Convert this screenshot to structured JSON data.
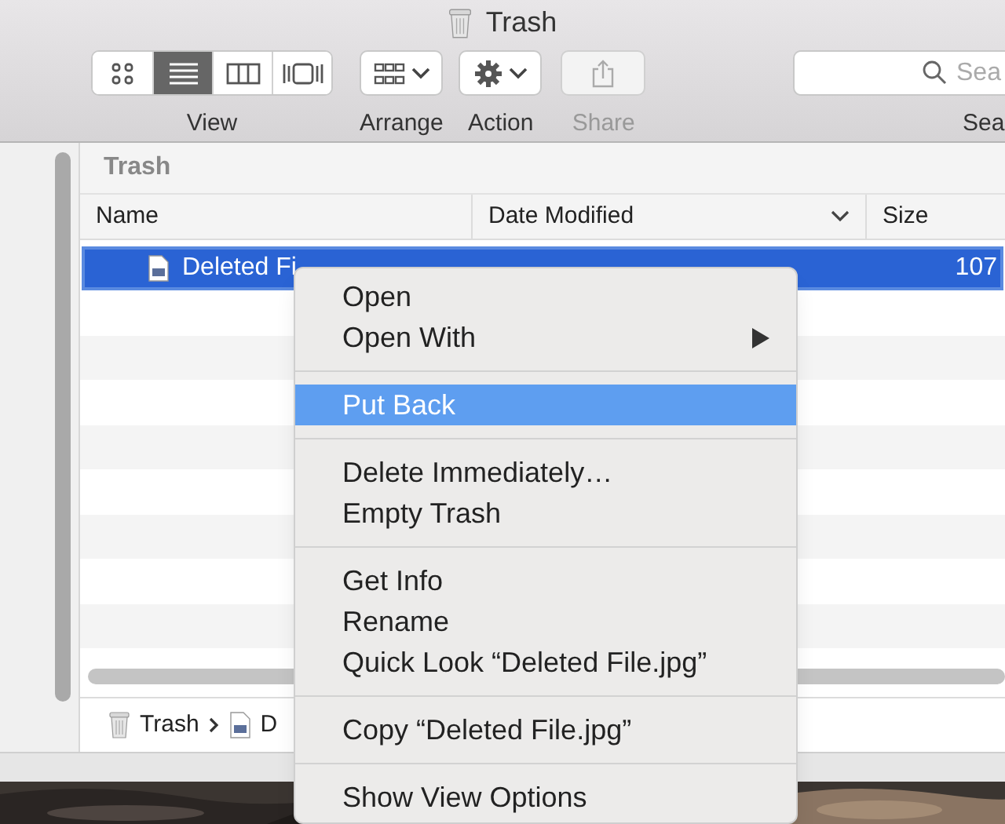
{
  "window": {
    "title": "Trash"
  },
  "toolbar": {
    "view_modes": [
      {
        "kind": "icons",
        "selected": false
      },
      {
        "kind": "list",
        "selected": true
      },
      {
        "kind": "columns",
        "selected": false
      },
      {
        "kind": "cover",
        "selected": false
      }
    ],
    "view_label": "View",
    "arrange_label": "Arrange",
    "action_label": "Action",
    "share": {
      "label": "Share",
      "disabled": true
    },
    "search": {
      "placeholder": "Sea",
      "label": "Sea"
    }
  },
  "location_header": "Trash",
  "table": {
    "columns": [
      {
        "label": "Name"
      },
      {
        "label": "Date Modified",
        "sorted": true
      },
      {
        "label": "Size"
      }
    ],
    "rows": [
      {
        "name": "Deleted Fi",
        "size": "107",
        "selected": true
      }
    ]
  },
  "path_bar": [
    "Trash",
    "D"
  ],
  "context_menu": [
    {
      "kind": "item",
      "label": "Open",
      "selected": false
    },
    {
      "kind": "item",
      "label": "Open With",
      "selected": false,
      "submenu": true
    },
    {
      "kind": "separator"
    },
    {
      "kind": "item",
      "label": "Put Back",
      "selected": true
    },
    {
      "kind": "separator"
    },
    {
      "kind": "item",
      "label": "Delete Immediately…",
      "selected": false
    },
    {
      "kind": "item",
      "label": "Empty Trash",
      "selected": false
    },
    {
      "kind": "separator"
    },
    {
      "kind": "item",
      "label": "Get Info",
      "selected": false
    },
    {
      "kind": "item",
      "label": "Rename",
      "selected": false
    },
    {
      "kind": "item",
      "label": "Quick Look “Deleted File.jpg”",
      "selected": false
    },
    {
      "kind": "separator"
    },
    {
      "kind": "item",
      "label": "Copy “Deleted File.jpg”",
      "selected": false
    },
    {
      "kind": "separator"
    },
    {
      "kind": "item",
      "label": "Show View Options",
      "selected": false
    }
  ]
}
